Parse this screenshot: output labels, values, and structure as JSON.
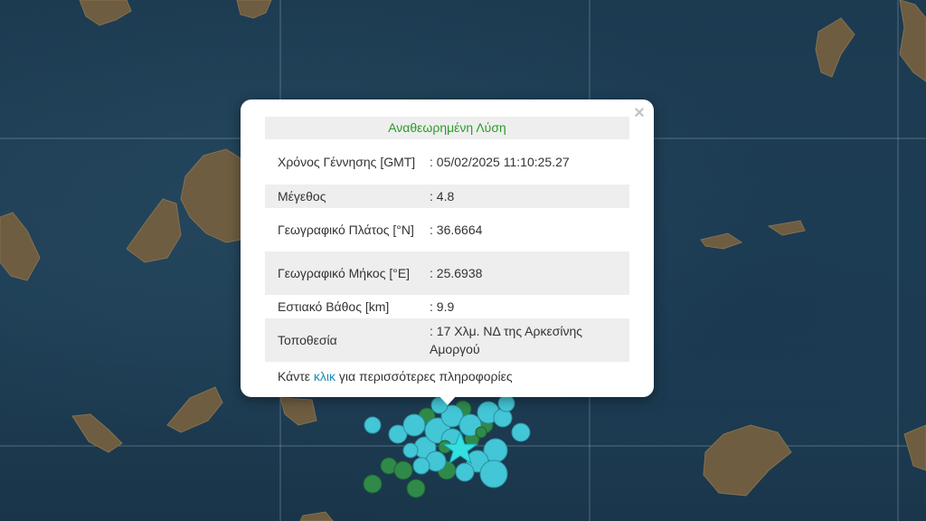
{
  "popup": {
    "title": "Αναθεωρημένη Λύση",
    "close_symbol": "×",
    "rows": [
      {
        "label": "Χρόνος Γέννησης [GMT]",
        "value": ": 05/02/2025 11:10:25.27"
      },
      {
        "label": "Μέγεθος",
        "value": ": 4.8"
      },
      {
        "label": "Γεωγραφικό Πλάτος [°N]",
        "value": ": 36.6664"
      },
      {
        "label": "Γεωγραφικό Μήκος [°E]",
        "value": ": 25.6938"
      },
      {
        "label": "Εστιακό Βάθος [km]",
        "value": ": 9.9"
      },
      {
        "label": "Τοποθεσία",
        "value": ": 17 Χλμ. ΝΔ της Αρκεσίνης Αμοργού"
      }
    ],
    "more_prefix": "Κάντε ",
    "more_link": "κλικ",
    "more_suffix": " για περισσότερες πληροφορίες"
  },
  "map": {
    "sea_color": "#1e3a4f",
    "land_color": "#6b5a3e",
    "event_colors": {
      "recent": "#43c6d6",
      "older": "#2f8a4a",
      "latest": "#33e0e0"
    }
  }
}
